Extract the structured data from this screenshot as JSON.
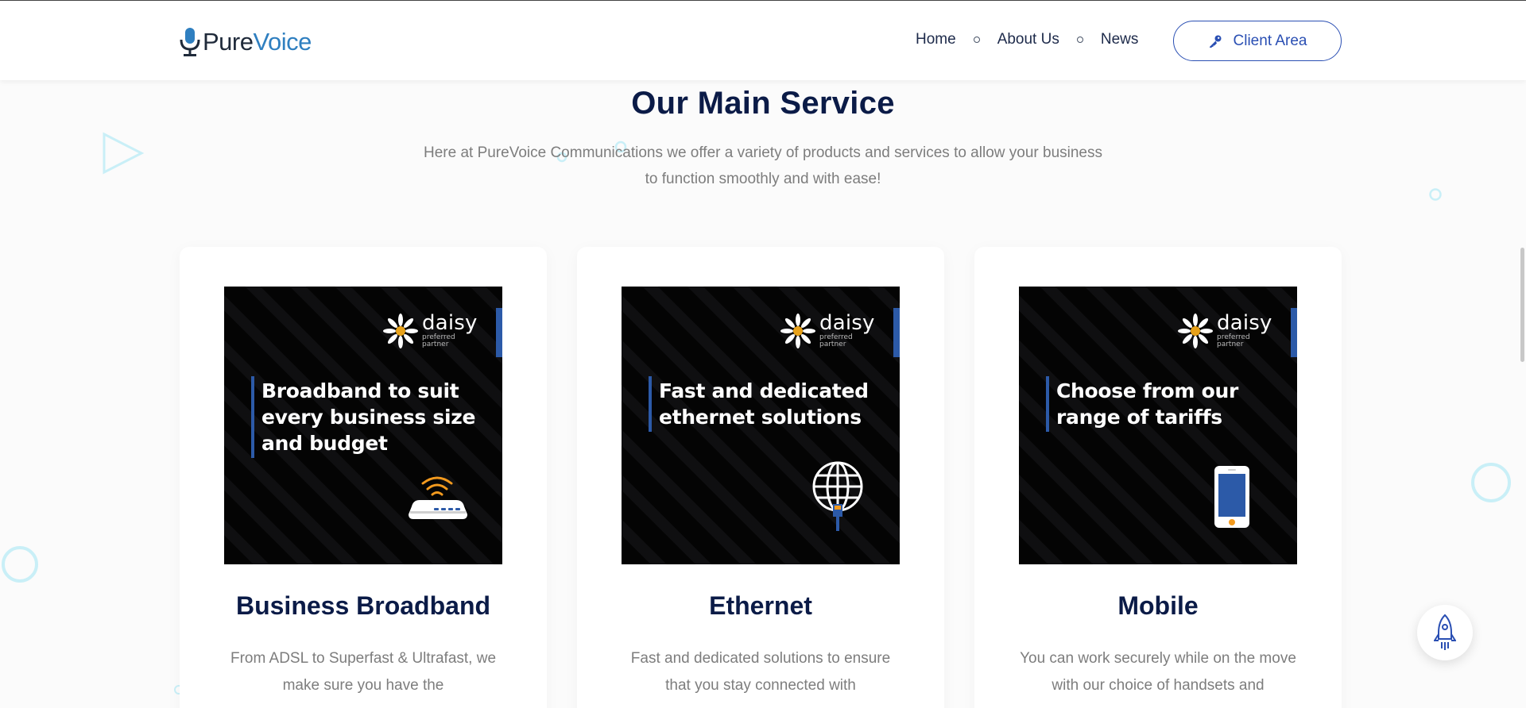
{
  "header": {
    "logo": {
      "part1": "Pure",
      "part2": "Voice"
    },
    "nav": [
      {
        "label": "Home"
      },
      {
        "label": "About Us"
      },
      {
        "label": "News"
      }
    ],
    "client_button": {
      "label": "Client Area",
      "icon": "key-icon"
    }
  },
  "section": {
    "title": "Our Main Service",
    "subtitle": "Here at PureVoice Communications we offer a variety of products and services to allow your business to function smoothly and with ease!"
  },
  "cards": [
    {
      "image": {
        "brand": "daisy",
        "brand_sub1": "preferred",
        "brand_sub2": "partner",
        "headline": "Broadband to suit every business size and budget",
        "icon": "router-icon"
      },
      "title": "Business Broadband",
      "description": "From ADSL to Superfast & Ultrafast, we make sure you have the"
    },
    {
      "image": {
        "brand": "daisy",
        "brand_sub1": "preferred",
        "brand_sub2": "partner",
        "headline": "Fast and dedicated ethernet solutions",
        "icon": "globe-cable-icon"
      },
      "title": "Ethernet",
      "description": "Fast and dedicated solutions to ensure that you stay connected with"
    },
    {
      "image": {
        "brand": "daisy",
        "brand_sub1": "preferred",
        "brand_sub2": "partner",
        "headline": "Choose from our range of tariffs",
        "icon": "mobile-phone-icon"
      },
      "title": "Mobile",
      "description": "You can work securely while on the move with our choice of handsets and"
    }
  ],
  "floating": {
    "icon": "rocket-icon"
  },
  "colors": {
    "navy": "#0b1b47",
    "accent_blue": "#2a4fb3",
    "brand_blue": "#2f7fc0",
    "deco_cyan": "#c9eff7",
    "card_bar_blue": "#2c5aa8"
  }
}
